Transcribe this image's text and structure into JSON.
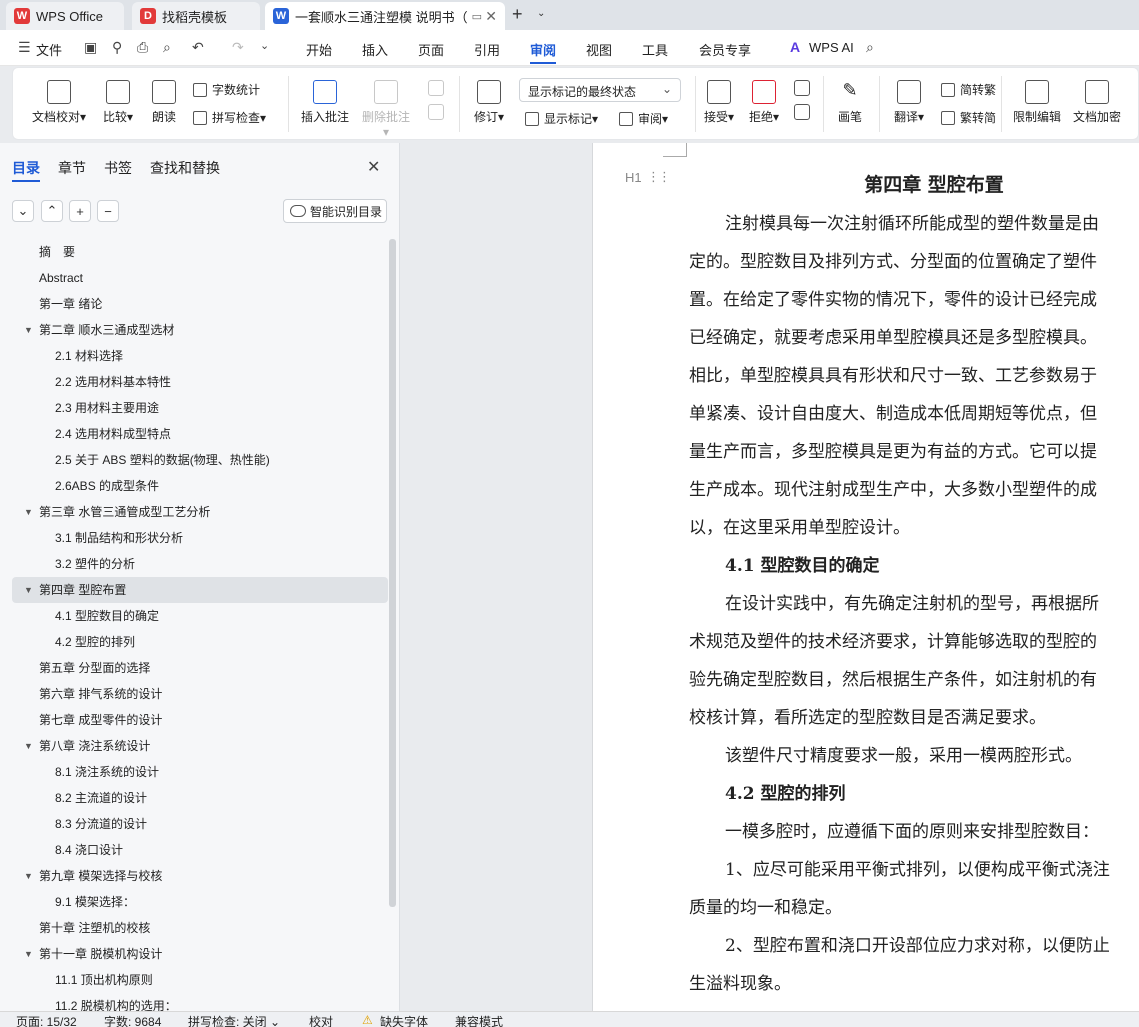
{
  "tabs": {
    "wps": "WPS Office",
    "template": "找稻壳模板",
    "doc": "一套顺水三通注塑模 说明书（"
  },
  "menu": {
    "file": "文件",
    "items": [
      "开始",
      "插入",
      "页面",
      "引用",
      "审阅",
      "视图",
      "工具",
      "会员专享"
    ],
    "ai": "WPS AI",
    "active": "审阅"
  },
  "ribbon": {
    "proofread": "文档校对",
    "compare": "比较",
    "read_aloud": "朗读",
    "word_count": "字数统计",
    "spell_check": "拼写检查",
    "insert_comment": "插入批注",
    "delete_comment": "删除批注",
    "revise": "修订",
    "display_select": "显示标记的最终状态",
    "show_marks": "显示标记",
    "review": "审阅",
    "accept": "接受",
    "reject": "拒绝",
    "pen": "画笔",
    "translate": "翻译",
    "to_traditional": "简转繁",
    "to_simplified": "繁转简",
    "restrict_edit": "限制编辑",
    "doc_encrypt": "文档加密"
  },
  "nav": {
    "tabs": [
      "目录",
      "章节",
      "书签",
      "查找和替换"
    ],
    "smart_toc": "智能识别目录",
    "toc": [
      {
        "level": 1,
        "text": "摘　要"
      },
      {
        "level": 1,
        "text": "Abstract"
      },
      {
        "level": 1,
        "text": "第一章 绪论"
      },
      {
        "level": 1,
        "text": "第二章 顺水三通成型选材",
        "expanded": true
      },
      {
        "level": 2,
        "text": "2.1 材料选择"
      },
      {
        "level": 2,
        "text": "2.2 选用材料基本特性"
      },
      {
        "level": 2,
        "text": "2.3 用材料主要用途"
      },
      {
        "level": 2,
        "text": "2.4 选用材料成型特点"
      },
      {
        "level": 2,
        "text": "2.5 关于 ABS 塑料的数据(物理、热性能)"
      },
      {
        "level": 2,
        "text": "2.6ABS 的成型条件"
      },
      {
        "level": 1,
        "text": "第三章 水管三通管成型工艺分析",
        "expanded": true
      },
      {
        "level": 2,
        "text": "3.1 制品结构和形状分析"
      },
      {
        "level": 2,
        "text": "3.2 塑件的分析"
      },
      {
        "level": 1,
        "text": "第四章 型腔布置",
        "expanded": true,
        "selected": true
      },
      {
        "level": 2,
        "text": "4.1 型腔数目的确定"
      },
      {
        "level": 2,
        "text": "4.2 型腔的排列"
      },
      {
        "level": 1,
        "text": "第五章 分型面的选择"
      },
      {
        "level": 1,
        "text": "第六章 排气系统的设计"
      },
      {
        "level": 1,
        "text": "第七章 成型零件的设计"
      },
      {
        "level": 1,
        "text": "第八章 浇注系统设计",
        "expanded": true
      },
      {
        "level": 2,
        "text": "8.1 浇注系统的设计"
      },
      {
        "level": 2,
        "text": "8.2 主流道的设计"
      },
      {
        "level": 2,
        "text": "8.3 分流道的设计"
      },
      {
        "level": 2,
        "text": "8.4 浇口设计"
      },
      {
        "level": 1,
        "text": "第九章 模架选择与校核",
        "expanded": true
      },
      {
        "level": 2,
        "text": "9.1 模架选择："
      },
      {
        "level": 1,
        "text": "第十章 注塑机的校核"
      },
      {
        "level": 1,
        "text": "第十一章 脱模机构设计",
        "expanded": true
      },
      {
        "level": 2,
        "text": "11.1 顶出机构原则"
      },
      {
        "level": 2,
        "text": "11.2 脱模机构的选用："
      }
    ]
  },
  "document": {
    "heading_marker": "H1",
    "title": "第四章  型腔布置",
    "lines": [
      {
        "type": "p",
        "indent": true,
        "text": "注射模具每一次注射循环所能成型的塑件数量是由"
      },
      {
        "type": "p",
        "indent": false,
        "text": "定的。型腔数目及排列方式、分型面的位置确定了塑件"
      },
      {
        "type": "p",
        "indent": false,
        "text": "置。在给定了零件实物的情况下，零件的设计已经完成"
      },
      {
        "type": "p",
        "indent": false,
        "text": "已经确定，就要考虑采用单型腔模具还是多型腔模具。"
      },
      {
        "type": "p",
        "indent": false,
        "text": "相比，单型腔模具具有形状和尺寸一致、工艺参数易于"
      },
      {
        "type": "p",
        "indent": false,
        "text": "单紧凑、设计自由度大、制造成本低周期短等优点，但"
      },
      {
        "type": "p",
        "indent": false,
        "text": "量生产而言，多型腔模具是更为有益的方式。它可以提"
      },
      {
        "type": "p",
        "indent": false,
        "text": "生产成本。现代注射成型生产中，大多数小型塑件的成"
      },
      {
        "type": "p",
        "indent": false,
        "text": "以，在这里采用单型腔设计。"
      },
      {
        "type": "h2",
        "text": "4.1  型腔数目的确定"
      },
      {
        "type": "p",
        "indent": true,
        "text": "在设计实践中，有先确定注射机的型号，再根据所"
      },
      {
        "type": "p",
        "indent": false,
        "text": "术规范及塑件的技术经济要求，计算能够选取的型腔的"
      },
      {
        "type": "p",
        "indent": false,
        "text": "验先确定型腔数目，然后根据生产条件，如注射机的有"
      },
      {
        "type": "p",
        "indent": false,
        "text": "校核计算，看所选定的型腔数目是否满足要求。"
      },
      {
        "type": "p",
        "indent": true,
        "text": "该塑件尺寸精度要求一般，采用一模两腔形式。"
      },
      {
        "type": "h2",
        "text": "4.2  型腔的排列"
      },
      {
        "type": "p",
        "indent": true,
        "text": "一模多腔时，应遵循下面的原则来安排型腔数目："
      },
      {
        "type": "p",
        "indent": true,
        "text": "1、应尽可能采用平衡式排列，以便构成平衡式浇注"
      },
      {
        "type": "p",
        "indent": false,
        "text": "质量的均一和稳定。"
      },
      {
        "type": "p",
        "indent": true,
        "text": "2、型腔布置和浇口开设部位应力求对称，以便防止"
      },
      {
        "type": "p",
        "indent": false,
        "text": "生溢料现象。"
      }
    ]
  },
  "status": {
    "page": "页面: 15/32",
    "words": "字数: 9684",
    "spell": "拼写检查: 关闭",
    "proof": "校对",
    "missing_font": "缺失字体",
    "compat": "兼容模式"
  },
  "colors": {
    "accent": "#1f5bd6",
    "wps_red": "#e23a3a",
    "doc_blue": "#2a64d8"
  }
}
